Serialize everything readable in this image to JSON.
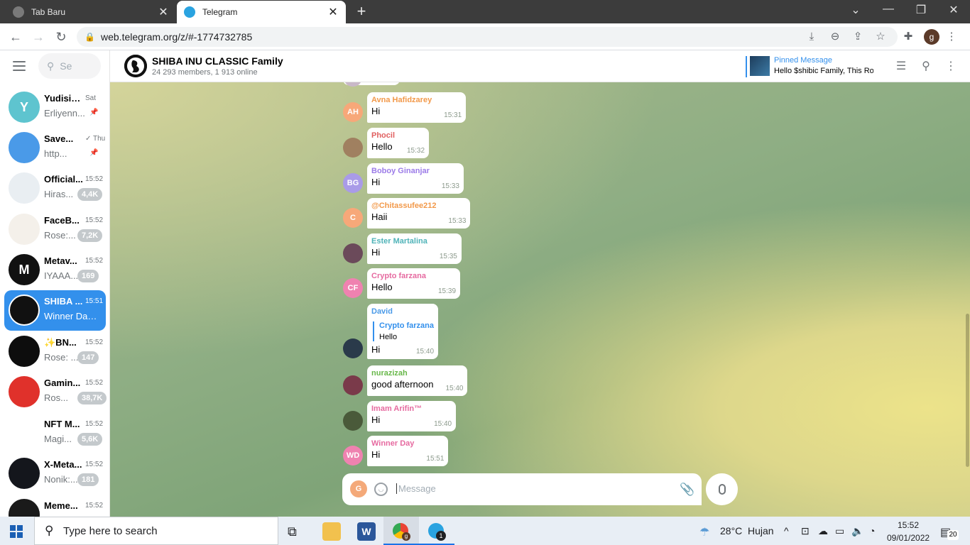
{
  "browser": {
    "tabs": [
      {
        "title": "Tab Baru",
        "active": false
      },
      {
        "title": "Telegram",
        "active": true
      }
    ],
    "url": "web.telegram.org/z/#-1774732785",
    "profile_initial": "g",
    "close_glyph": "✕",
    "new_tab_glyph": "+",
    "icons": [
      "back-icon",
      "forward-icon",
      "reload-icon",
      "lock-icon",
      "download-icon",
      "zoom-icon",
      "share-icon",
      "star-icon",
      "extensions-icon",
      "menu-icon"
    ]
  },
  "sidebar": {
    "search_placeholder": "Se",
    "chats": [
      {
        "name": "Yudisium...",
        "time": "Sat",
        "preview": "Erliyenn...",
        "badge": "",
        "pinned": true,
        "avatar_text": "Y",
        "avatar_color": "#5ec4cf"
      },
      {
        "name": "Save...",
        "time": "✓ Thu",
        "preview": "http...",
        "badge": "",
        "pinned": true,
        "avatar_text": "",
        "avatar_color": "#4a9ae8"
      },
      {
        "name": "Official...",
        "time": "15:52",
        "preview": "Hiras...",
        "badge": "4,4K",
        "pinned": false,
        "avatar_text": "",
        "avatar_color": "#e9eef2"
      },
      {
        "name": "FaceB...",
        "time": "15:52",
        "preview": "Rose:...",
        "badge": "7,2K",
        "pinned": false,
        "avatar_text": "",
        "avatar_color": "#f4f0ea"
      },
      {
        "name": "Metav...",
        "time": "15:52",
        "preview": "IYAAA...",
        "badge": "169",
        "pinned": false,
        "avatar_text": "M",
        "avatar_color": "#111111"
      },
      {
        "name": "SHIBA ...",
        "time": "15:51",
        "preview": "Winner Day:...",
        "badge": "",
        "pinned": false,
        "avatar_text": "",
        "avatar_color": "#111111",
        "active": true
      },
      {
        "name": "✨BN...",
        "time": "15:52",
        "preview": "Rose: ...",
        "badge": "147",
        "pinned": false,
        "avatar_text": "",
        "avatar_color": "#0d0d0d"
      },
      {
        "name": "Gamin...",
        "time": "15:52",
        "preview": "Ros...",
        "badge": "38,7K",
        "pinned": false,
        "avatar_text": "",
        "avatar_color": "#e0312b"
      },
      {
        "name": "NFT M...",
        "time": "15:52",
        "preview": "Magi...",
        "badge": "5,6K",
        "pinned": false,
        "avatar_text": "",
        "avatar_color": "#ffffff"
      },
      {
        "name": "X-Meta...",
        "time": "15:52",
        "preview": "Nonik:...",
        "badge": "181",
        "pinned": false,
        "avatar_text": "",
        "avatar_color": "#14161c"
      },
      {
        "name": "Meme...",
        "time": "15:52",
        "preview": "",
        "badge": "",
        "pinned": false,
        "avatar_text": "",
        "avatar_color": "#1a1a1a"
      }
    ]
  },
  "header": {
    "title": "SHIBA INU CLASSIC Family",
    "subtitle": "24 293 members, 1 913 online",
    "pinned_label": "Pinned Message",
    "pinned_text": "Hello $shibic Family, This Ro..."
  },
  "messages": [
    {
      "sender": "Avna Hafidzarey",
      "text": "Hi",
      "time": "15:31",
      "initials": "AH",
      "name_color": "#f2994a",
      "avatar_color": "#f7a879"
    },
    {
      "sender": "Phocil",
      "text": "Hello",
      "time": "15:32",
      "initials": "",
      "name_color": "#e06060",
      "avatar_color": "#a08060"
    },
    {
      "sender": "Boboy Ginanjar",
      "text": "Hi",
      "time": "15:33",
      "initials": "BG",
      "name_color": "#9b7be8",
      "avatar_color": "#a99be8"
    },
    {
      "sender": "@Chitassufee212",
      "text": "Haii",
      "time": "15:33",
      "initials": "C",
      "name_color": "#f2994a",
      "avatar_color": "#f7a879"
    },
    {
      "sender": "Ester Martalina",
      "text": "Hi",
      "time": "15:35",
      "initials": "",
      "name_color": "#4fb3b8",
      "avatar_color": "#6b4a5a"
    },
    {
      "sender": "Crypto farzana",
      "text": "Hello",
      "time": "15:39",
      "initials": "CF",
      "name_color": "#e66aa0",
      "avatar_color": "#ef82b0"
    },
    {
      "sender": "David",
      "text": "Hi",
      "time": "15:40",
      "initials": "",
      "name_color": "#4a9ae8",
      "avatar_color": "#2a3a4a",
      "reply_name": "Crypto farzana",
      "reply_text": "Hello"
    },
    {
      "sender": "nurazizah",
      "text": "good afternoon",
      "time": "15:40",
      "initials": "",
      "name_color": "#68b84a",
      "avatar_color": "#7a3a4a"
    },
    {
      "sender": "Imam Arifin™",
      "text": "Hi",
      "time": "15:40",
      "initials": "",
      "name_color": "#e66aa0",
      "avatar_color": "#4a5a3a"
    },
    {
      "sender": "Winner Day",
      "text": "Hi",
      "time": "15:51",
      "initials": "WD",
      "name_color": "#e66aa0",
      "avatar_color": "#ef82b0"
    }
  ],
  "composer": {
    "placeholder": "Message",
    "user_initial": "G"
  },
  "taskbar": {
    "search_placeholder": "Type here to search",
    "weather_temp": "28°C",
    "weather_text": "Hujan",
    "time": "15:52",
    "date": "09/01/2022",
    "notification_count": "20",
    "chrome_badge": "g",
    "telegram_badge": "1"
  }
}
